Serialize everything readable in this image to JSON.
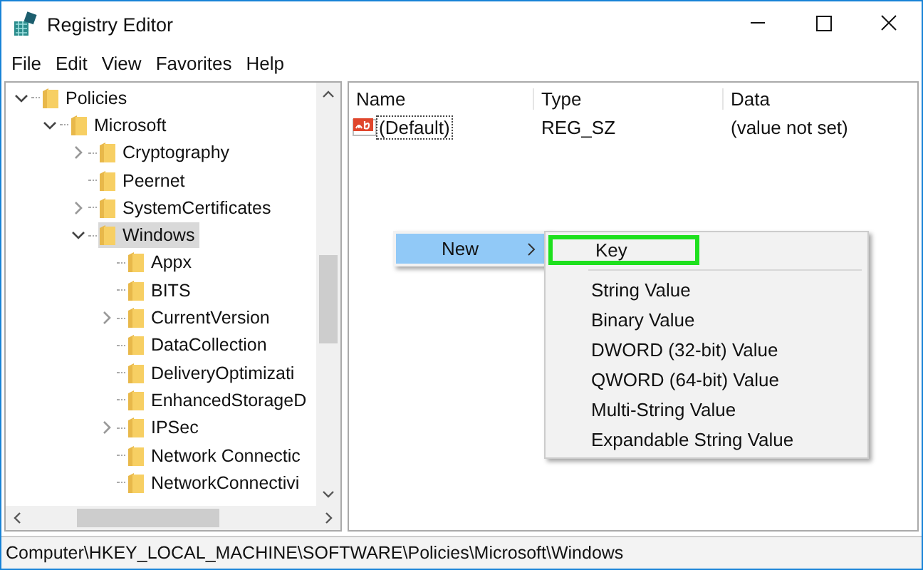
{
  "window": {
    "title": "Registry Editor"
  },
  "menu": [
    "File",
    "Edit",
    "View",
    "Favorites",
    "Help"
  ],
  "tree": [
    {
      "label": "Policies",
      "expanded": true,
      "selected": false,
      "children": [
        {
          "label": "Microsoft",
          "expanded": true,
          "selected": false,
          "children": [
            {
              "label": "Cryptography",
              "expanded": false,
              "selected": false
            },
            {
              "label": "Peernet",
              "selected": false
            },
            {
              "label": "SystemCertificates",
              "expanded": false,
              "selected": false
            },
            {
              "label": "Windows",
              "expanded": true,
              "selected": true,
              "children": [
                {
                  "label": "Appx",
                  "selected": false
                },
                {
                  "label": "BITS",
                  "selected": false
                },
                {
                  "label": "CurrentVersion",
                  "expanded": false,
                  "selected": false
                },
                {
                  "label": "DataCollection",
                  "selected": false
                },
                {
                  "label": "DeliveryOptimizati",
                  "selected": false
                },
                {
                  "label": "EnhancedStorageD",
                  "selected": false
                },
                {
                  "label": "IPSec",
                  "expanded": false,
                  "selected": false
                },
                {
                  "label": "Network Connectic",
                  "selected": false
                },
                {
                  "label": "NetworkConnectivi",
                  "selected": false
                }
              ]
            }
          ]
        }
      ]
    }
  ],
  "table": {
    "columns": [
      "Name",
      "Type",
      "Data"
    ],
    "rows": [
      {
        "name": "(Default)",
        "type": "REG_SZ",
        "data": "(value not set)"
      }
    ]
  },
  "context_menu": {
    "label": "New",
    "submenu": [
      {
        "label": "Key",
        "highlighted": true,
        "separator_after": true
      },
      {
        "label": "String Value",
        "highlighted": false
      },
      {
        "label": "Binary Value",
        "highlighted": false
      },
      {
        "label": "DWORD (32-bit) Value",
        "highlighted": false
      },
      {
        "label": "QWORD (64-bit) Value",
        "highlighted": false
      },
      {
        "label": "Multi-String Value",
        "highlighted": false
      },
      {
        "label": "Expandable String Value",
        "highlighted": false
      }
    ]
  },
  "status_bar": "Computer\\HKEY_LOCAL_MACHINE\\SOFTWARE\\Policies\\Microsoft\\Windows"
}
